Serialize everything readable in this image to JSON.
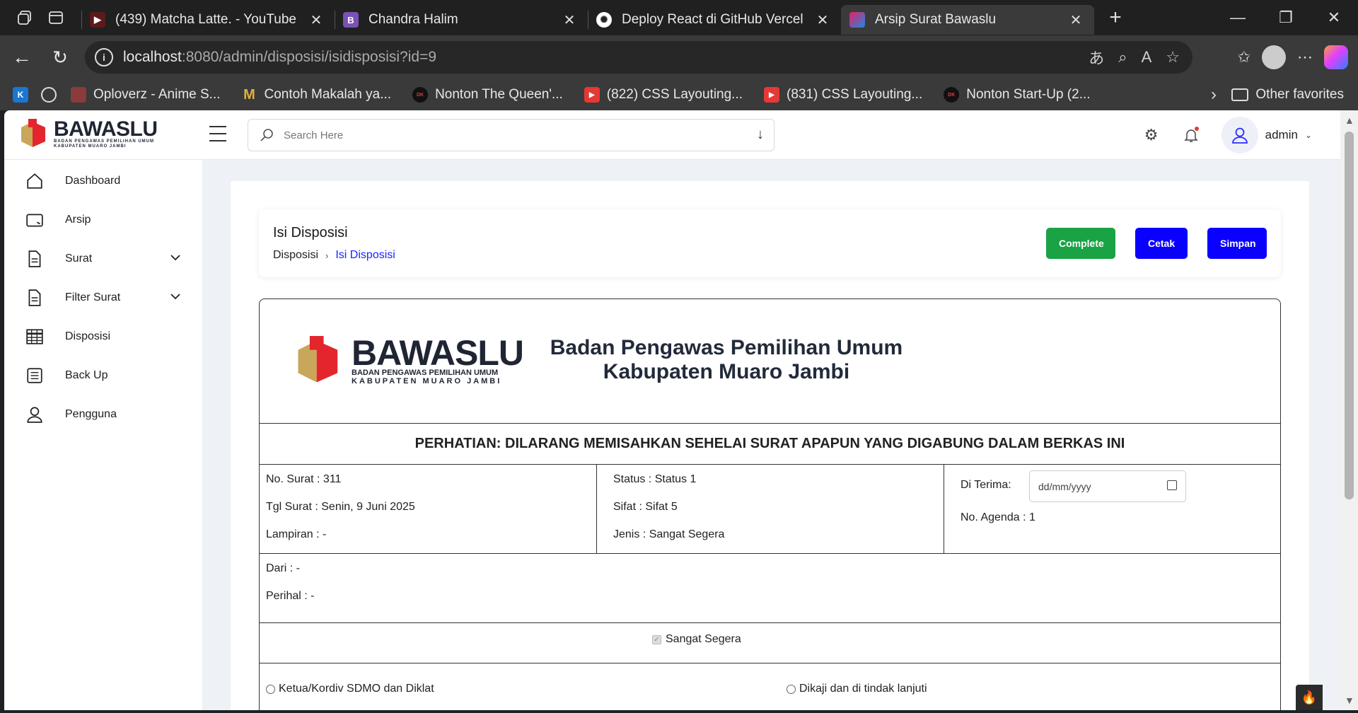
{
  "browser": {
    "tabs": [
      {
        "title": "(439) Matcha Latte. - YouTube",
        "icon": "youtube-icon",
        "color": "#c4302b"
      },
      {
        "title": "Chandra Halim",
        "icon": "bootstrap-icon",
        "color": "#7952b3"
      },
      {
        "title": "Deploy React di GitHub Vercel",
        "icon": "openai-icon",
        "color": "#ffffff"
      },
      {
        "title": "Arsip Surat Bawaslu",
        "icon": "bawaslu-icon",
        "color": "#1e88e5"
      }
    ],
    "url_host": "localhost",
    "url_path": ":8080/admin/disposisi/isidisposisi?id=9",
    "bookmarks": [
      {
        "label": "Oploverz - Anime S...",
        "icon": "oploverz-icon"
      },
      {
        "label": "Contoh Makalah ya...",
        "icon": "m-icon"
      },
      {
        "label": "Nonton The Queen'...",
        "icon": "drakor-icon"
      },
      {
        "label": "(822) CSS Layouting...",
        "icon": "youtube-icon"
      },
      {
        "label": "(831) CSS Layouting...",
        "icon": "youtube-icon"
      },
      {
        "label": "Nonton Start-Up (2...",
        "icon": "drakor-icon"
      }
    ],
    "other_favorites": "Other favorites"
  },
  "topnav": {
    "logo_text": "BAWASLU",
    "logo_sub1": "BADAN PENGAWAS PEMILIHAN UMUM",
    "logo_sub2": "KABUPATEN MUARO JAMBI",
    "search_placeholder": "Search Here",
    "username": "admin"
  },
  "sidebar": {
    "items": [
      {
        "label": "Dashboard",
        "icon": "home-icon"
      },
      {
        "label": "Arsip",
        "icon": "archive-icon"
      },
      {
        "label": "Surat",
        "icon": "document-icon"
      },
      {
        "label": "Filter Surat",
        "icon": "document-icon"
      },
      {
        "label": "Disposisi",
        "icon": "table-icon"
      },
      {
        "label": "Back Up",
        "icon": "backup-icon"
      },
      {
        "label": "Pengguna",
        "icon": "user-icon"
      }
    ]
  },
  "header": {
    "title": "Isi Disposisi",
    "breadcrumb_parent": "Disposisi",
    "breadcrumb_current": "Isi Disposisi",
    "btn_complete": "Complete",
    "btn_cetak": "Cetak",
    "btn_simpan": "Simpan"
  },
  "doc": {
    "logo_text": "BAWASLU",
    "logo_sub1": "BADAN PENGAWAS PEMILIHAN UMUM",
    "logo_sub2": "KABUPATEN MUARO JAMBI",
    "org_line1": "Badan Pengawas Pemilihan Umum",
    "org_line2": "Kabupaten Muaro Jambi",
    "warning": "PERHATIAN: DILARANG MEMISAHKAN SEHELAI SURAT APAPUN YANG DIGABUNG DALAM BERKAS INI",
    "no_surat": "No. Surat : 311",
    "tgl_surat": "Tgl Surat : Senin, 9 Juni 2025",
    "lampiran": "Lampiran : -",
    "status": "Status : Status 1",
    "sifat": "Sifat : Sifat 5",
    "jenis": "Jenis : Sangat Segera",
    "di_terima_label": "Di Terima:",
    "di_terima_placeholder": "dd/mm/yyyy",
    "no_agenda": "No. Agenda : 1",
    "dari": "Dari : -",
    "perihal": "Perihal : -",
    "checkbox_label": "Sangat Segera",
    "radio_left": "Ketua/Kordiv SDMO dan Diklat",
    "radio_right": "Dikaji dan di tindak lanjuti"
  }
}
